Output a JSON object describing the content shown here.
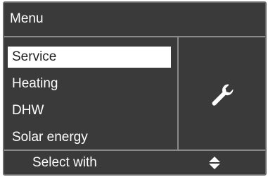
{
  "header": {
    "title": "Menu"
  },
  "menu": {
    "items": [
      {
        "label": "Service",
        "selected": true
      },
      {
        "label": "Heating",
        "selected": false
      },
      {
        "label": "DHW",
        "selected": false
      },
      {
        "label": "Solar energy",
        "selected": false
      }
    ]
  },
  "side_panel": {
    "icon": "wrench-icon"
  },
  "footer": {
    "hint": "Select with",
    "icon": "up-down-arrows-icon"
  },
  "colors": {
    "screen_bg": "#3a3a3a",
    "text": "#ffffff",
    "selected_bg": "#ffffff",
    "selected_text": "#1f1f1f",
    "divider": "#8a8a8a"
  }
}
